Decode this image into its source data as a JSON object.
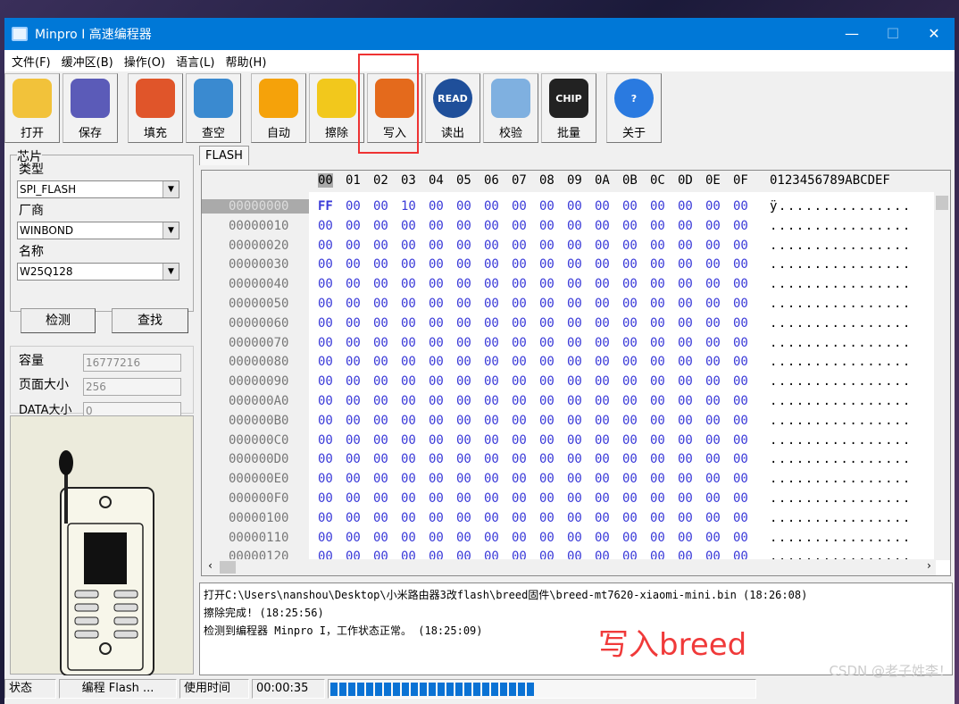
{
  "window": {
    "title": "Minpro I 高速编程器",
    "minimize": "—",
    "maximize": "☐",
    "close": "✕"
  },
  "menu": [
    "文件(F)",
    "缓冲区(B)",
    "操作(O)",
    "语言(L)",
    "帮助(H)"
  ],
  "toolbar": [
    {
      "label": "打开",
      "icon": "open-folder-icon",
      "color": "#f2c23a"
    },
    {
      "label": "保存",
      "icon": "floppy-disk-icon",
      "color": "#5b5bb8"
    },
    {
      "label": "填充",
      "icon": "flask-icon",
      "color": "#e0552a"
    },
    {
      "label": "查空",
      "icon": "magnifier-icon",
      "color": "#3a8ad0"
    },
    {
      "label": "自动",
      "icon": "running-man-icon",
      "color": "#f5a20a"
    },
    {
      "label": "擦除",
      "icon": "open-box-icon",
      "color": "#f2c81c"
    },
    {
      "label": "写入",
      "icon": "pen-paper-icon",
      "color": "#e46a1c"
    },
    {
      "label": "读出",
      "icon": "read-disc-icon",
      "color": "#1f4f9a",
      "text": "READ"
    },
    {
      "label": "校验",
      "icon": "document-search-icon",
      "color": "#7fb0e0"
    },
    {
      "label": "批量",
      "icon": "chip-icon",
      "color": "#222",
      "text": "CHIP"
    },
    {
      "label": "关于",
      "icon": "help-icon",
      "color": "#2a7ae0",
      "text": "?"
    }
  ],
  "chip": {
    "group": "芯片",
    "type_label": "类型",
    "type": "SPI_FLASH",
    "vendor_label": "厂商",
    "vendor": "WINBOND",
    "name_label": "名称",
    "name": "W25Q128",
    "detect": "检测",
    "find": "查找"
  },
  "info": {
    "capacity_label": "容量",
    "capacity": "16777216",
    "page_label": "页面大小",
    "page": "256",
    "data_label": "DATA大小",
    "data": "0"
  },
  "buffer": {
    "tab": "FLASH",
    "columns": [
      "00",
      "01",
      "02",
      "03",
      "04",
      "05",
      "06",
      "07",
      "08",
      "09",
      "0A",
      "0B",
      "0C",
      "0D",
      "0E",
      "0F"
    ],
    "ascii_header": "0123456789ABCDEF",
    "rows": [
      {
        "addr": "00000000",
        "bytes": [
          "FF",
          "00",
          "00",
          "10",
          "00",
          "00",
          "00",
          "00",
          "00",
          "00",
          "00",
          "00",
          "00",
          "00",
          "00",
          "00"
        ],
        "ascii": "ÿ..............."
      },
      {
        "addr": "00000010",
        "bytes": "zero",
        "ascii": "................"
      },
      {
        "addr": "00000020",
        "bytes": "zero",
        "ascii": "................"
      },
      {
        "addr": "00000030",
        "bytes": "zero",
        "ascii": "................"
      },
      {
        "addr": "00000040",
        "bytes": "zero",
        "ascii": "................"
      },
      {
        "addr": "00000050",
        "bytes": "zero",
        "ascii": "................"
      },
      {
        "addr": "00000060",
        "bytes": "zero",
        "ascii": "................"
      },
      {
        "addr": "00000070",
        "bytes": "zero",
        "ascii": "................"
      },
      {
        "addr": "00000080",
        "bytes": "zero",
        "ascii": "................"
      },
      {
        "addr": "00000090",
        "bytes": "zero",
        "ascii": "................"
      },
      {
        "addr": "000000A0",
        "bytes": "zero",
        "ascii": "................"
      },
      {
        "addr": "000000B0",
        "bytes": "zero",
        "ascii": "................"
      },
      {
        "addr": "000000C0",
        "bytes": "zero",
        "ascii": "................"
      },
      {
        "addr": "000000D0",
        "bytes": "zero",
        "ascii": "................"
      },
      {
        "addr": "000000E0",
        "bytes": "zero",
        "ascii": "................"
      },
      {
        "addr": "000000F0",
        "bytes": "zero",
        "ascii": "................"
      },
      {
        "addr": "00000100",
        "bytes": "zero",
        "ascii": "................"
      },
      {
        "addr": "00000110",
        "bytes": "zero",
        "ascii": "................"
      },
      {
        "addr": "00000120",
        "bytes": "zero",
        "ascii": "................"
      }
    ]
  },
  "log": [
    "打开C:\\Users\\nanshou\\Desktop\\小米路由器3改flash\\breed固件\\breed-mt7620-xiaomi-mini.bin (18:26:08)",
    "擦除完成! (18:25:56)",
    "检测到编程器 Minpro I，工作状态正常。 (18:25:09)"
  ],
  "annotation": "写入breed",
  "status": {
    "state_label": "状态",
    "state": "编程 Flash ...",
    "time_label": "使用时间",
    "time": "00:00:35",
    "progress": 0.48
  },
  "watermark": "CSDN @老子姓李！",
  "colors": {
    "title_bar": "#0078d7",
    "hex_value": "#3a3ad8",
    "progress": "#0a72d4",
    "annotation": "#f03a3a"
  }
}
